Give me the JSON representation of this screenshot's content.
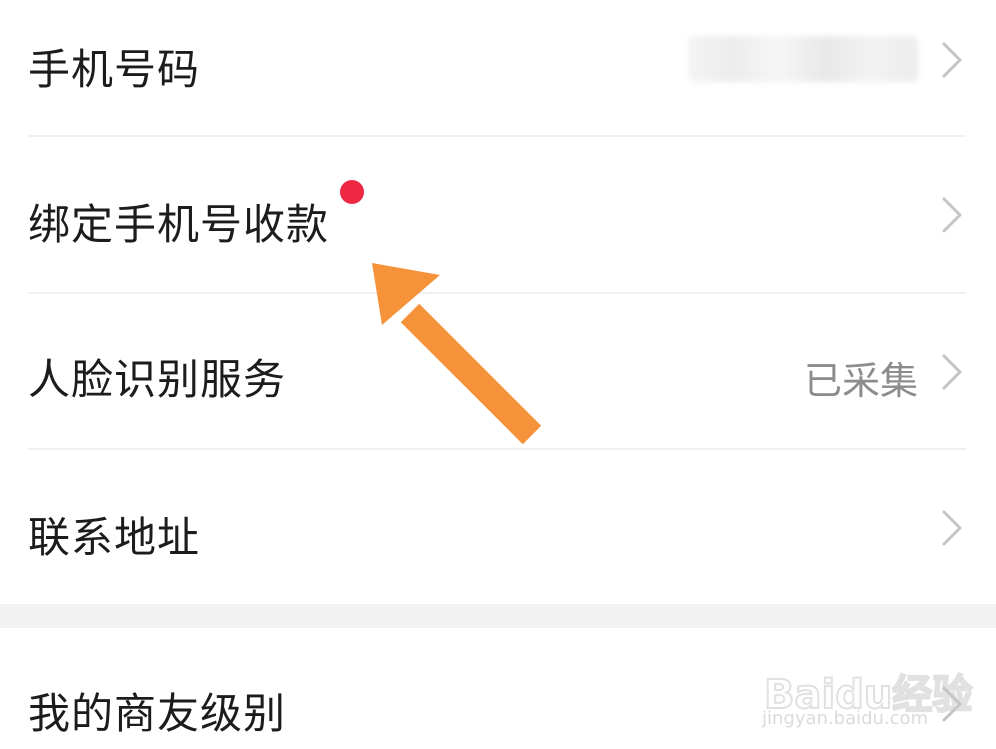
{
  "settings": {
    "rows": [
      {
        "label": "手机号码",
        "value": ""
      },
      {
        "label": "绑定手机号收款",
        "value": "",
        "has_badge": true
      },
      {
        "label": "人脸识别服务",
        "value": "已采集"
      },
      {
        "label": "联系地址",
        "value": ""
      },
      {
        "label": "我的商友级别",
        "value": ""
      }
    ]
  },
  "watermark": {
    "brand": "Baidu经验",
    "url": "jingyan.baidu.com"
  },
  "colors": {
    "badge": "#ee2746",
    "arrow": "#f5923a",
    "label_text": "#1c1c1c",
    "value_text": "#8c8c8c"
  },
  "icons": {
    "chevron": "chevron-right-icon",
    "annotation": "arrow-annotation-icon"
  }
}
